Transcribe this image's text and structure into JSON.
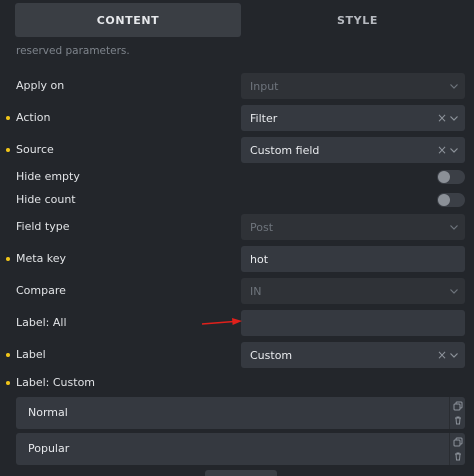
{
  "tabs": {
    "content": "CONTENT",
    "style": "STYLE"
  },
  "intro": {
    "line1": "",
    "line2": "reserved parameters."
  },
  "fields": {
    "apply_on": {
      "label": "Apply on",
      "value": "Input"
    },
    "action": {
      "label": "Action",
      "value": "Filter"
    },
    "source": {
      "label": "Source",
      "value": "Custom field"
    },
    "hide_empty": {
      "label": "Hide empty"
    },
    "hide_count": {
      "label": "Hide count"
    },
    "field_type": {
      "label": "Field type",
      "value": "Post"
    },
    "meta_key": {
      "label": "Meta key",
      "value": "hot"
    },
    "compare": {
      "label": "Compare",
      "value": "IN"
    },
    "label_all": {
      "label": "Label: All",
      "value": ""
    },
    "label": {
      "label": "Label",
      "value": "Custom"
    },
    "label_custom": {
      "label": "Label: Custom"
    }
  },
  "custom_items": [
    {
      "text": "Normal"
    },
    {
      "text": "Popular"
    }
  ],
  "icons": {
    "clear": "×",
    "chevron": "chevron-down-icon",
    "copy": "copy-icon",
    "trash": "trash-icon"
  },
  "colors": {
    "background": "#23262b",
    "field": "#353940",
    "accent_dot": "#f0c419",
    "annotation_arrow": "#e0201b"
  }
}
